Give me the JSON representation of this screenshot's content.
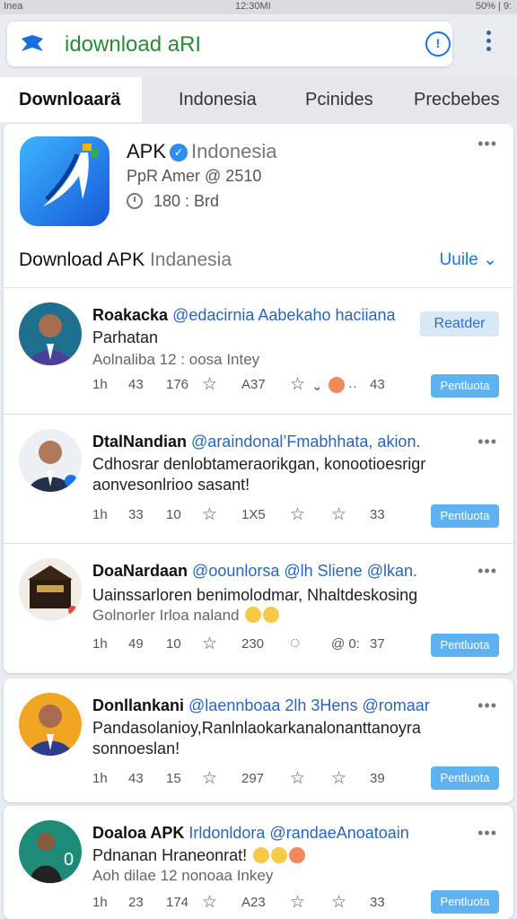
{
  "status_bar": {
    "left": "Inea",
    "center": "12:30MI",
    "right": "50% | 9:"
  },
  "address_bar": {
    "text": "idownload aRI"
  },
  "tabs": [
    "Downloaarä",
    "Indonesia",
    "Pcinides",
    "Precbebes"
  ],
  "app": {
    "name": "APK",
    "region": "Indonesia",
    "developer": "PpR Amer @ 2510",
    "meta": "180 : Brd",
    "section_title": "Download APK",
    "section_title_muted": "Indanesia",
    "section_link": "Uuile ⌄"
  },
  "posts": [
    {
      "name": "Roakacka",
      "handle": "@edacirnia Aabekaho haciiana",
      "text": "Parhatan",
      "meta": "Aolnaliba 12 : oosa Intey",
      "actions": [
        "1h",
        "43",
        "176",
        "A37",
        "43"
      ],
      "badge": "Reatder",
      "cta": "Pentluota"
    },
    {
      "name": "DtalNandian",
      "handle": "@araindonal’Fmabhhata, akion.",
      "text": "Cdhosrar denlobtameraorikgan, konootioesrigr aonvesonlrioo sasant!",
      "meta": "",
      "actions": [
        "1h",
        "33",
        "10",
        "1X5",
        "33"
      ],
      "badge": "",
      "cta": "Pentluota"
    },
    {
      "name": "DoaNardaan",
      "handle": "@oounlorsa @lh Sliene @lkan.",
      "text": "Uainssarloren benimolodmar, Nhaltdeskosing",
      "meta": "Golnorler Irloa naland",
      "actions": [
        "1h",
        "49",
        "10",
        "230",
        "37"
      ],
      "badge": "",
      "cta": "Pentluota"
    },
    {
      "name": "Donllankani",
      "handle": "@laennboaa 2lh 3Hens @romaar",
      "text": "Pandasolanioy,Ranlnlaokarkanalonanttanoyra sonnoeslan!",
      "meta": "",
      "actions": [
        "1h",
        "43",
        "15",
        "297",
        "39"
      ],
      "badge": "",
      "cta": "Pentluota"
    },
    {
      "name": "Doaloa APK",
      "handle": "Irldonldora @randaeAnoatoain",
      "text": "Pdnanan Hraneonrat!",
      "meta": "Aoh dilae 12 nonoaa Inkey",
      "actions": [
        "1h",
        "23",
        "174",
        "A23",
        "33"
      ],
      "badge": "",
      "cta": "Pentluota"
    }
  ],
  "colors": {
    "accent": "#1a73e8",
    "cta": "#5eb2f0",
    "handle": "#2a65b8"
  }
}
